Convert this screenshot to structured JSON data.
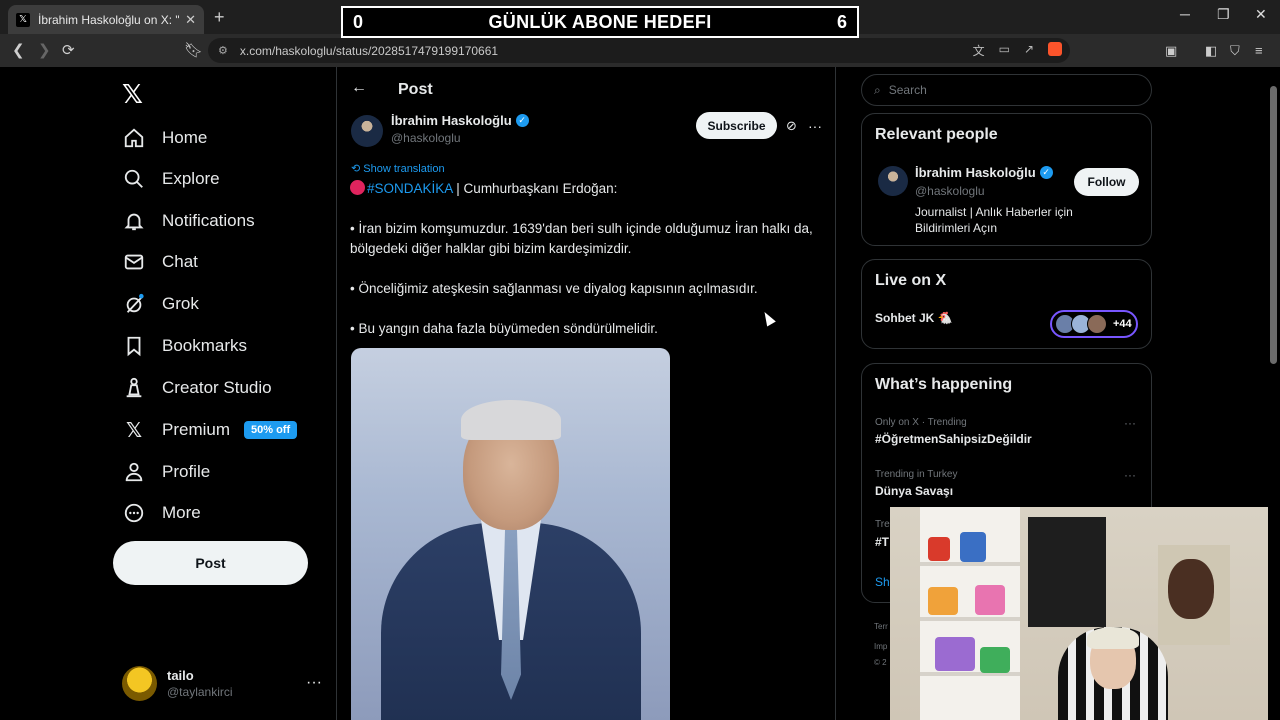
{
  "browser": {
    "tab_title": "İbrahim Haskoloğlu on X: \"🔴#S",
    "url": "x.com/haskologlu/status/2028517479199170661"
  },
  "overlay": {
    "left_count": "0",
    "title": "GÜNLÜK ABONE HEDEFI",
    "right_count": "6"
  },
  "nav": {
    "items": [
      {
        "label": "Home",
        "icon": "home-icon"
      },
      {
        "label": "Explore",
        "icon": "search-icon"
      },
      {
        "label": "Notifications",
        "icon": "bell-icon"
      },
      {
        "label": "Chat",
        "icon": "mail-icon"
      },
      {
        "label": "Grok",
        "icon": "grok-icon"
      },
      {
        "label": "Bookmarks",
        "icon": "bookmark-icon"
      },
      {
        "label": "Creator Studio",
        "icon": "creator-icon"
      },
      {
        "label": "Premium",
        "icon": "x-icon"
      },
      {
        "label": "Profile",
        "icon": "person-icon"
      },
      {
        "label": "More",
        "icon": "more-circle-icon"
      }
    ],
    "premium_badge": "50% off",
    "post_button": "Post"
  },
  "account": {
    "name": "tailo",
    "handle": "@taylankirci"
  },
  "post": {
    "header": "Post",
    "author_name": "İbrahim Haskoloğlu",
    "author_handle": "@haskologlu",
    "subscribe_label": "Subscribe",
    "show_translation": "Show translation",
    "hashtag": "#SONDAKİKA",
    "headline_rest": " | Cumhurbaşkanı Erdoğan:",
    "bullet1": "• İran bizim komşumuzdur. 1639'dan beri sulh içinde olduğumuz İran halkı da, bölgedeki diğer halklar gibi bizim kardeşimizdir.",
    "bullet2": "• Önceliğimiz ateşkesin sağlanması ve diyalog kapısının açılmasıdır.",
    "bullet3": "• Bu yangın daha fazla büyümeden söndürülmelidir."
  },
  "right": {
    "search_placeholder": "Search",
    "relevant_title": "Relevant people",
    "relevant_name": "İbrahim Haskoloğlu",
    "relevant_handle": "@haskologlu",
    "relevant_bio": "Journalist | Anlık Haberler için Bildirimleri Açın",
    "follow_label": "Follow",
    "live_title": "Live on X",
    "live_room": "Sohbet JK 🐔",
    "live_count": "+44",
    "happening_title": "What’s happening",
    "trends": [
      {
        "meta": "Only on X · Trending",
        "name": "#ÖğretmenSahipsizDeğildir"
      },
      {
        "meta": "Trending in Turkey",
        "name": "Dünya Savaşı"
      }
    ],
    "partial_trend_meta": "Tre",
    "partial_trend_name": "#T",
    "partial_show": "Sh",
    "footer1": "Terr",
    "footer2": "Imp",
    "footer3": "© 2"
  },
  "colors": {
    "accent": "#1d9bf0",
    "background": "#000000",
    "live_ring": "#7856ff"
  }
}
